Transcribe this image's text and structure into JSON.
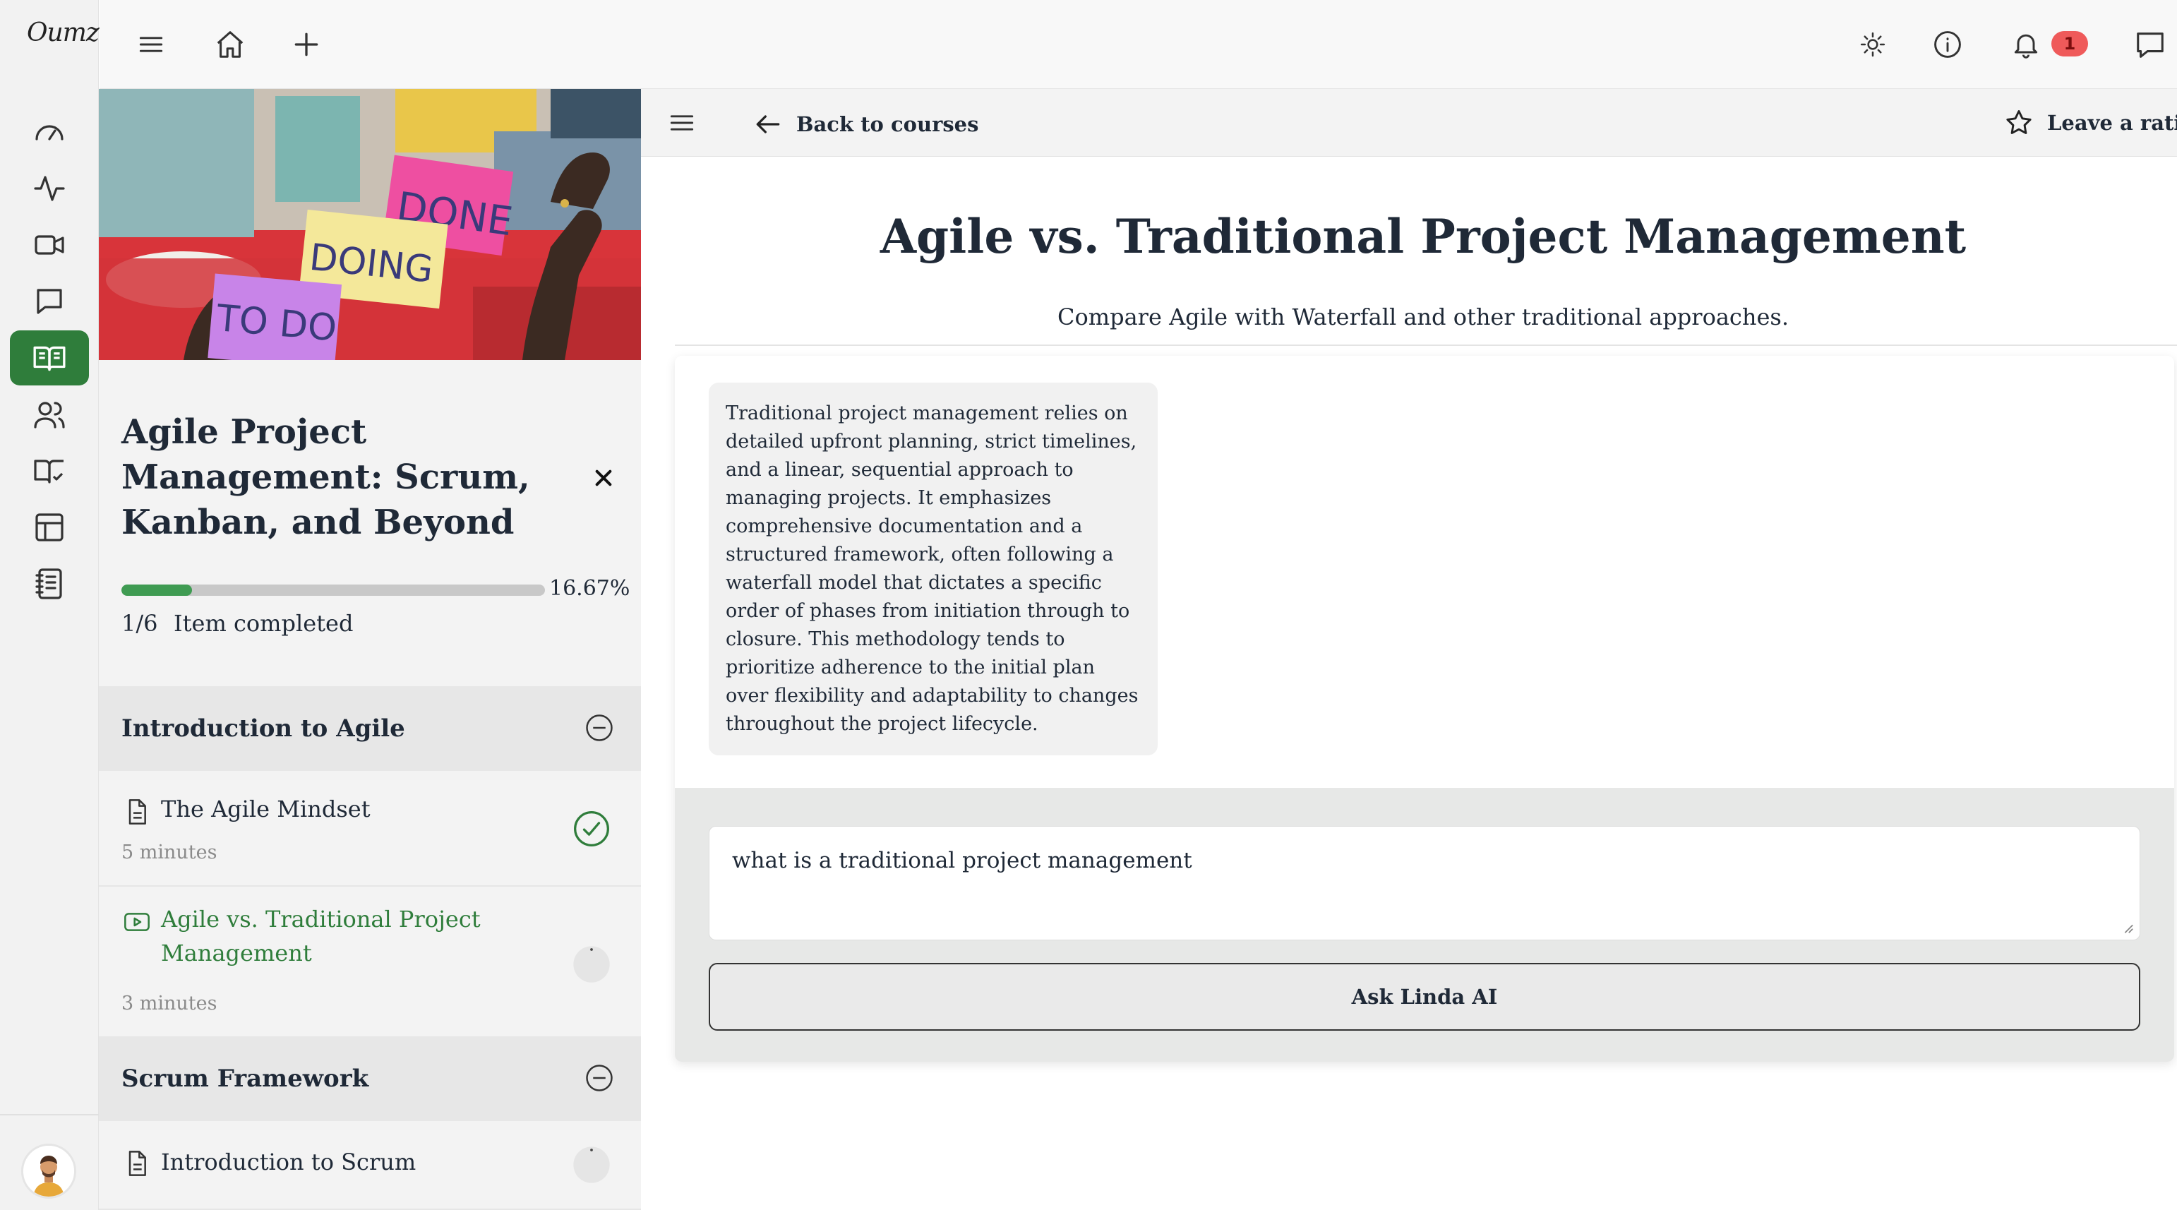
{
  "app": {
    "logo_text": "Oumz",
    "notification_count": "1"
  },
  "rail": {
    "items": [
      {
        "name": "dashboard-icon"
      },
      {
        "name": "activity-icon"
      },
      {
        "name": "video-icon"
      },
      {
        "name": "chat-icon"
      },
      {
        "name": "courses-icon",
        "active": true
      },
      {
        "name": "users-icon"
      },
      {
        "name": "book-check-icon"
      },
      {
        "name": "layout-icon"
      },
      {
        "name": "notes-icon"
      }
    ]
  },
  "course": {
    "hero_notes": [
      "DONE",
      "DOING",
      "TO DO"
    ],
    "title": "Agile Project Management: Scrum, Kanban, and Beyond",
    "progress_fraction": 0.1667,
    "progress_percent": "16.67%",
    "progress_count": "1/6",
    "progress_label": "Item completed",
    "sections": [
      {
        "title": "Introduction to Agile",
        "lessons": [
          {
            "title": "The Agile Mindset",
            "duration": "5 minutes",
            "type": "document",
            "status": "completed"
          },
          {
            "title": "Agile vs. Traditional Project Management",
            "duration": "3 minutes",
            "type": "video",
            "status": "current"
          }
        ]
      },
      {
        "title": "Scrum Framework",
        "lessons": [
          {
            "title": "Introduction to Scrum",
            "type": "document",
            "status": "pending"
          }
        ]
      }
    ]
  },
  "subbar": {
    "back_label": "Back to courses",
    "rating_label": "Leave a rating"
  },
  "lesson": {
    "title": "Agile vs. Traditional Project Management",
    "subtitle": "Compare Agile with Waterfall and other traditional approaches."
  },
  "chat": {
    "response": "Traditional project management relies on detailed upfront planning, strict timelines, and a linear, sequential approach to managing projects. It emphasizes comprehensive documentation and a structured framework, often following a waterfall model that dictates a specific order of phases from initiation through to closure. This methodology tends to prioritize adherence to the initial plan over flexibility and adaptability to changes throughout the project lifecycle.",
    "input_value": "what is a traditional project management",
    "ask_button": "Ask Linda AI"
  },
  "colors": {
    "accent_green": "#2f7d3b",
    "progress_green": "#3f9b52",
    "badge_red": "#ef5a5a"
  }
}
